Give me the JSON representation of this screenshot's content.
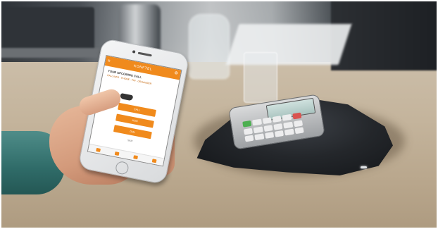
{
  "photo": {
    "subject": "Konftel conference phone with smartphone app",
    "app": {
      "brand": "KONFTEL",
      "heading": "YOUR UPCOMING CALL",
      "call_info": "CALL INFO · PHONE · PIN · ORGANIZER",
      "buttons": [
        "CALL",
        "JOIN",
        "DIAL"
      ],
      "skip_label": "SKIP",
      "accent_color": "#f08a1c"
    },
    "colors": {
      "device": "#24272b",
      "table": "#c4b49c",
      "sleeve": "#2f6b68"
    }
  }
}
